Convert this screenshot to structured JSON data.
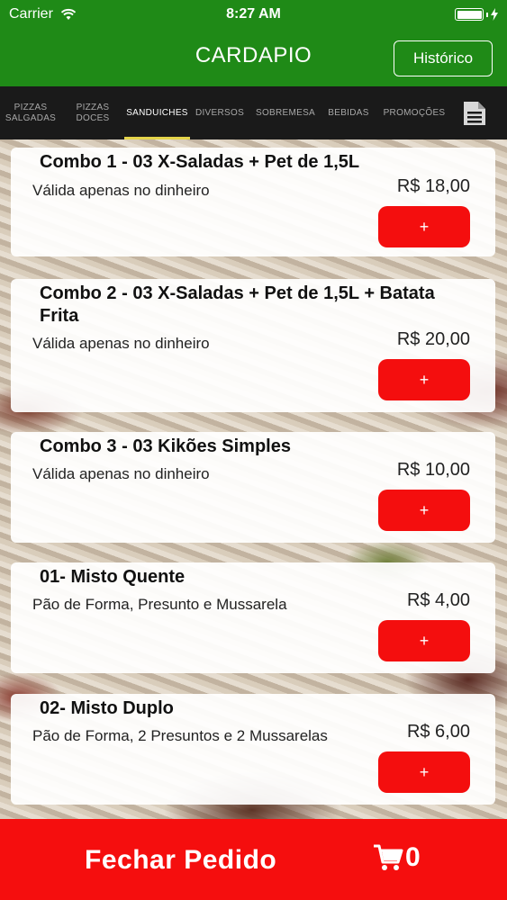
{
  "status_bar": {
    "carrier": "Carrier",
    "time": "8:27 AM"
  },
  "nav": {
    "title": "CARDAPIO",
    "history_label": "Histórico"
  },
  "tabs": [
    {
      "label_line1": "PIZZAS",
      "label_line2": "SALGADAS"
    },
    {
      "label_line1": "PIZZAS",
      "label_line2": "DOCES"
    },
    {
      "label_line1": "SANDUICHES",
      "label_line2": ""
    },
    {
      "label_line1": "DIVERSOS",
      "label_line2": ""
    },
    {
      "label_line1": "SOBREMESA",
      "label_line2": ""
    },
    {
      "label_line1": "BEBIDAS",
      "label_line2": ""
    },
    {
      "label_line1": "PROMOÇÕES",
      "label_line2": ""
    }
  ],
  "active_tab": "SANDUICHES",
  "products": [
    {
      "title": "Combo 1 - 03 X-Saladas + Pet de 1,5L",
      "description": "Válida apenas no dinheiro",
      "price": "R$ 18,00",
      "add_label": "+"
    },
    {
      "title": "Combo 2 - 03 X-Saladas + Pet de 1,5L + Batata Frita",
      "description": "Válida apenas no dinheiro",
      "price": "R$ 20,00",
      "add_label": "+"
    },
    {
      "title": "Combo 3 - 03 Kikões Simples",
      "description": "Válida apenas no dinheiro",
      "price": "R$ 10,00",
      "add_label": "+"
    },
    {
      "title": "01- Misto Quente",
      "description": "Pão de Forma, Presunto e Mussarela",
      "price": "R$ 4,00",
      "add_label": "+"
    },
    {
      "title": "02- Misto Duplo",
      "description": "Pão de Forma, 2 Presuntos e 2 Mussarelas",
      "price": "R$ 6,00",
      "add_label": "+"
    }
  ],
  "footer": {
    "label": "Fechar Pedido",
    "cart_count": "0"
  },
  "colors": {
    "header_green": "#1f8a17",
    "accent_red": "#f40e0e",
    "tab_underline": "#e4d44a"
  },
  "icons": {
    "wifi": "wifi-icon",
    "charging": "bolt-icon",
    "document": "document-icon",
    "cart": "cart-icon"
  }
}
